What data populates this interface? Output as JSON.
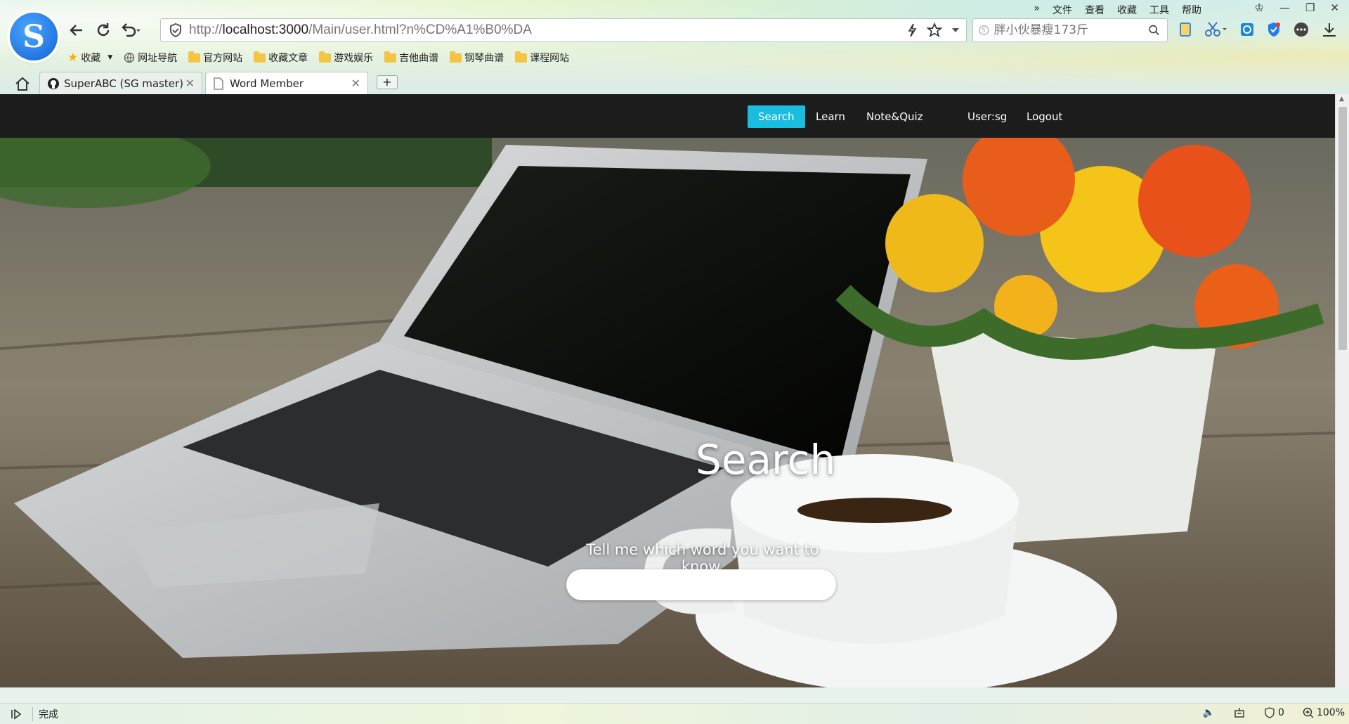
{
  "browser": {
    "address": {
      "url_prefix": "http://",
      "host": "localhost:3000",
      "path": "/Main/user.html?n%CD%A1%B0%DA"
    },
    "search_placeholder": "胖小伙暴瘦173斤",
    "menu": [
      "文件",
      "查看",
      "收藏",
      "工具",
      "帮助"
    ],
    "bookmarks": [
      {
        "label": "收藏",
        "icon": "star-icon"
      },
      {
        "label": "网址导航",
        "icon": "globe-icon"
      },
      {
        "label": "官方网站",
        "icon": "folder-icon"
      },
      {
        "label": "收藏文章",
        "icon": "folder-icon"
      },
      {
        "label": "游戏娱乐",
        "icon": "folder-icon"
      },
      {
        "label": "吉他曲谱",
        "icon": "folder-icon"
      },
      {
        "label": "钢琴曲谱",
        "icon": "folder-icon"
      },
      {
        "label": "课程网站",
        "icon": "folder-icon"
      }
    ],
    "tabs": [
      {
        "label": "SuperABC (SG master)",
        "icon": "github-icon",
        "active": false
      },
      {
        "label": "Word Member",
        "icon": "page-icon",
        "active": true
      }
    ],
    "new_tab_label": "+",
    "status": {
      "text": "完成",
      "blocked_count": "0",
      "zoom": "100%"
    }
  },
  "site": {
    "nav": [
      {
        "label": "Search",
        "active": true
      },
      {
        "label": "Learn",
        "active": false
      },
      {
        "label": "Note&Quiz",
        "active": false
      },
      {
        "label": "User:sg",
        "active": false
      },
      {
        "label": "Logout",
        "active": false
      }
    ],
    "hero": {
      "title": "Search",
      "subtitle": "Tell me which word you want to know.",
      "input_value": ""
    },
    "colors": {
      "nav_bg": "#1c1c1c",
      "accent": "#19bde0"
    }
  }
}
